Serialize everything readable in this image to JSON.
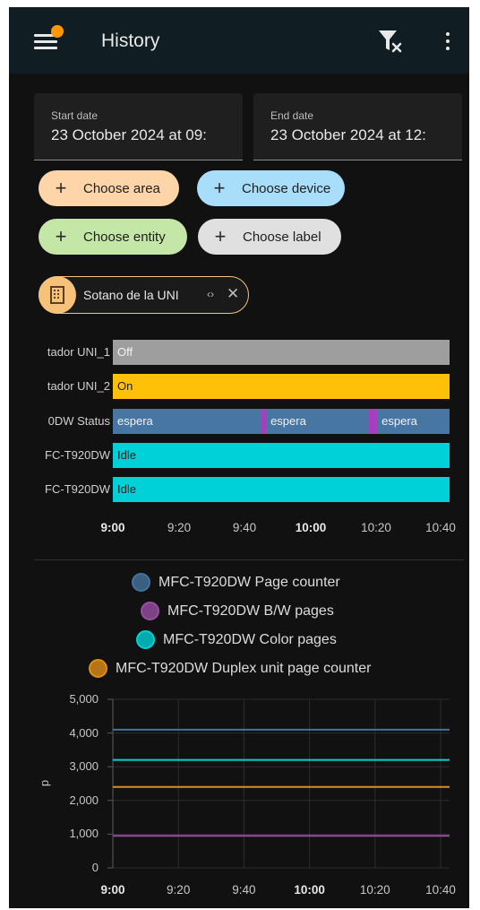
{
  "app": {
    "title": "History",
    "icons": {
      "menu": "menu-icon",
      "filter_clear": "filter-remove-icon",
      "more": "more-vert-icon",
      "notification_dot": "notification-dot"
    }
  },
  "dates": {
    "start_label": "Start date",
    "start_value": "23 October 2024 at 09:",
    "end_label": "End date",
    "end_value": "23 October 2024 at 12:"
  },
  "target_pickers": [
    {
      "label": "Choose area",
      "color": "#fdd5a8"
    },
    {
      "label": "Choose device",
      "color": "#a9defa"
    },
    {
      "label": "Choose entity",
      "color": "#c4e6a7"
    },
    {
      "label": "Choose label",
      "color": "#e0e0e0"
    }
  ],
  "selected_filter": {
    "label": "Sotano de la UNI",
    "icon": "area-grid-icon",
    "expand": "‹›",
    "remove": "✕"
  },
  "timeline": {
    "rows": [
      {
        "label": "tador UNI_1",
        "segments": [
          {
            "label": "Off",
            "color": "#9e9e9e",
            "text_color": "#f2f2f2",
            "start": 0,
            "end": 100
          }
        ]
      },
      {
        "label": "tador UNI_2",
        "segments": [
          {
            "label": "On",
            "color": "#ffc107",
            "text_color": "#1e1e1e",
            "start": 0,
            "end": 100
          }
        ]
      },
      {
        "label": "0DW Status",
        "segments": [
          {
            "label": "espera",
            "color": "#4876a3",
            "text_color": "#f2f2f2",
            "start": 0,
            "end": 44
          },
          {
            "label": "",
            "color": "#a53fbf",
            "text_color": "#f2f2f2",
            "start": 44,
            "end": 45.5
          },
          {
            "label": "espera",
            "color": "#4876a3",
            "text_color": "#f2f2f2",
            "start": 45.5,
            "end": 76
          },
          {
            "label": "",
            "color": "#a53fbf",
            "text_color": "#f2f2f2",
            "start": 76,
            "end": 78.5
          },
          {
            "label": "espera",
            "color": "#4876a3",
            "text_color": "#f2f2f2",
            "start": 78.5,
            "end": 100
          }
        ]
      },
      {
        "label": "FC-T920DW",
        "segments": [
          {
            "label": "Idle",
            "color": "#00d1d8",
            "text_color": "#1e1e1e",
            "start": 0,
            "end": 100
          }
        ]
      },
      {
        "label": "FC-T920DW",
        "segments": [
          {
            "label": "Idle",
            "color": "#00d1d8",
            "text_color": "#1e1e1e",
            "start": 0,
            "end": 100
          }
        ]
      }
    ],
    "x_ticks": [
      {
        "label": "9:00",
        "bold": true
      },
      {
        "label": "9:20",
        "bold": false
      },
      {
        "label": "9:40",
        "bold": false
      },
      {
        "label": "10:00",
        "bold": true
      },
      {
        "label": "10:20",
        "bold": false
      },
      {
        "label": "10:40",
        "bold": false
      }
    ]
  },
  "chart_data": {
    "type": "line",
    "x_ticks": [
      "9:00",
      "9:20",
      "9:40",
      "10:00",
      "10:20",
      "10:40"
    ],
    "x_bold": [
      "9:00",
      "10:00"
    ],
    "ylabel": "p",
    "y_ticks": [
      "0",
      "1,000",
      "2,000",
      "3,000",
      "4,000",
      "5,000"
    ],
    "ylim": [
      0,
      5000
    ],
    "grid": true,
    "legend_position": "top",
    "series": [
      {
        "name": "MFC-T920DW Page counter",
        "color": "#44739e",
        "values": [
          4100,
          4100
        ]
      },
      {
        "name": "MFC-T920DW B/W pages",
        "color": "#984ea3",
        "values": [
          950,
          950
        ]
      },
      {
        "name": "MFC-T920DW Color pages",
        "color": "#00d2d5",
        "values": [
          3200,
          3200
        ]
      },
      {
        "name": "MFC-T920DW Duplex unit page counter",
        "color": "#e08e15",
        "values": [
          2400,
          2400
        ]
      }
    ]
  }
}
